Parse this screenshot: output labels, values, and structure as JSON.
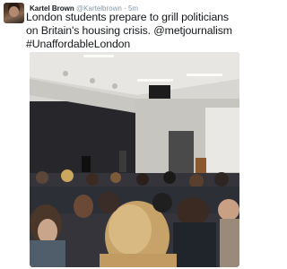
{
  "tweet": {
    "display_name": "Kartel Brown",
    "handle": "@Kartelbrown",
    "separator": "·",
    "time": "5m",
    "text": "London students prepare to grill politicians on Britain's housing crisis. @metjournalism #UnaffordableLondon"
  },
  "media": {
    "icon": "photo-icon"
  },
  "colors": {
    "text": "#14171a",
    "muted": "#8899a6",
    "background": "#ffffff"
  }
}
